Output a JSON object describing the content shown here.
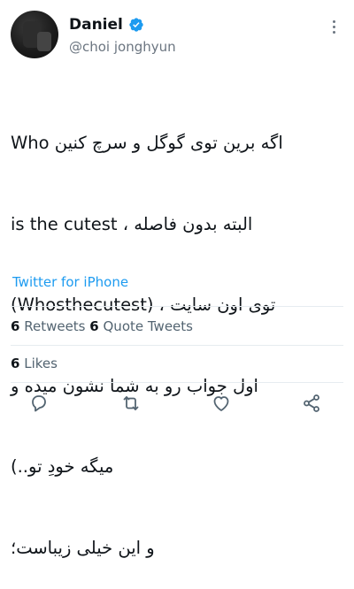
{
  "author": {
    "display_name": "Daniel",
    "handle": "@choi jonghyun",
    "verified": true
  },
  "tweet": {
    "lines": [
      "اگه برین توی گوگل و سرچ کنین Who",
      "is the cutest ، البته بدون فاصله",
      "(Whosthecutest) ، توی اون سایت",
      "اول جواب رو به شما نشون میده و",
      "میگه خودِ تو..)",
      "و این خیلی زیباست؛"
    ],
    "source": "Twitter for iPhone"
  },
  "stats": {
    "retweets_count": "6",
    "retweets_label": "Retweets",
    "quote_count": "6",
    "quote_label": "Quote Tweets",
    "likes_count": "6",
    "likes_label": "Likes"
  },
  "actions": [
    {
      "icon": "reply-icon"
    },
    {
      "icon": "retweet-icon"
    },
    {
      "icon": "like-icon"
    },
    {
      "icon": "share-icon"
    }
  ],
  "colors": {
    "accent": "#1d9bf0",
    "text": "#0f1419",
    "secondary": "#536471",
    "divider": "#e6ecf0"
  }
}
